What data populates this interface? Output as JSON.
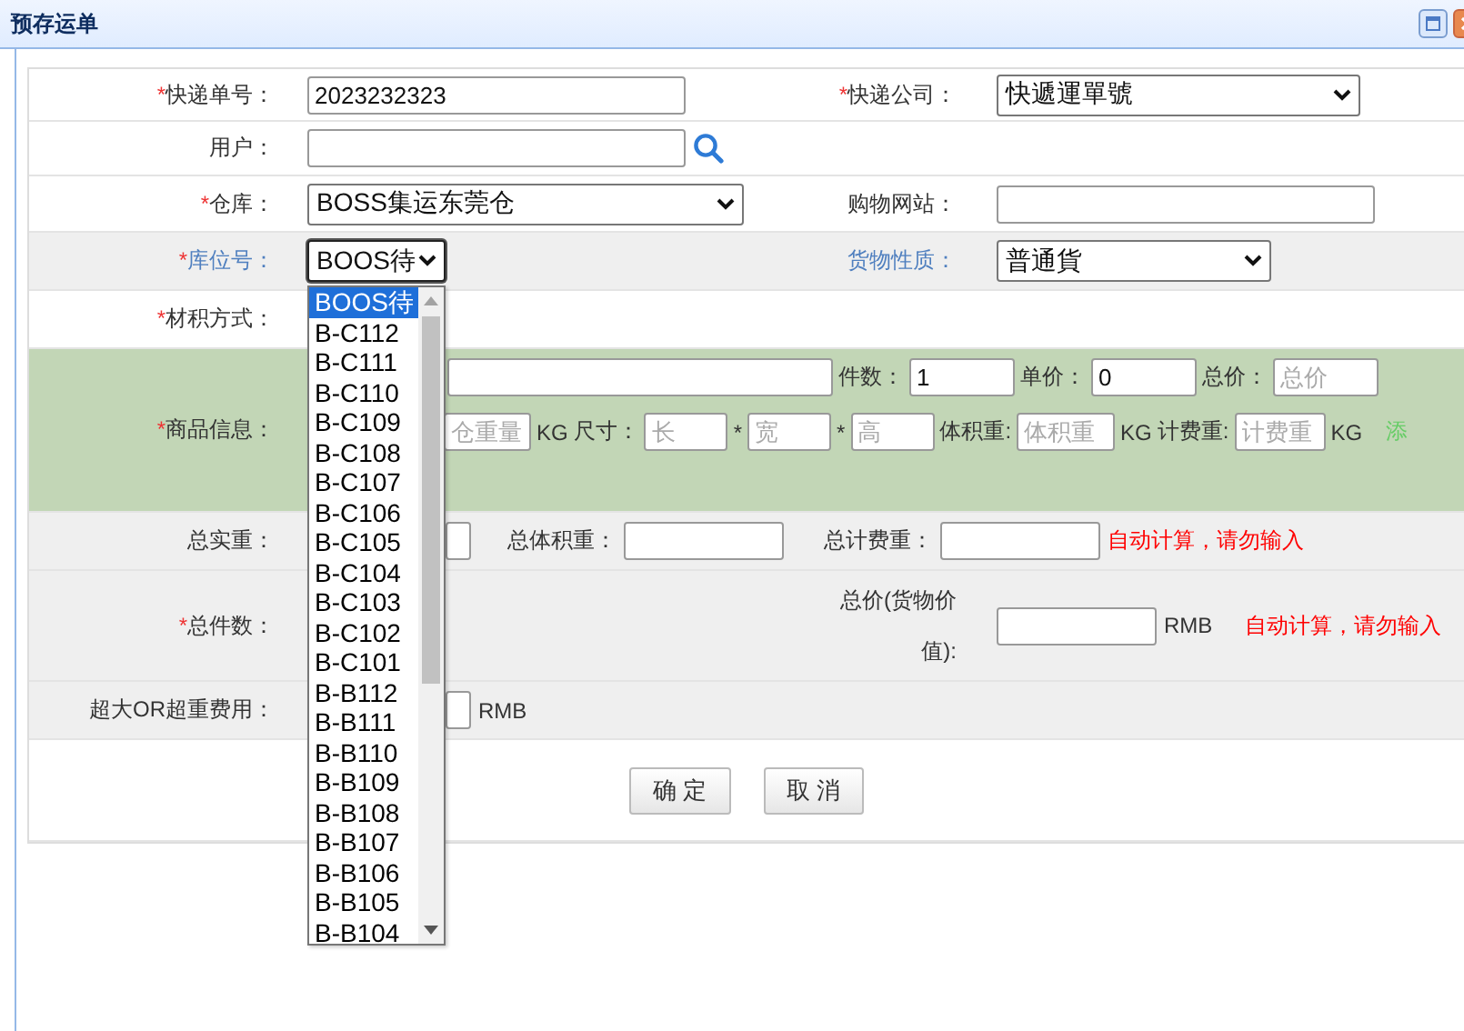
{
  "window": {
    "title": "预存运单"
  },
  "express_no": {
    "label": "快递单号：",
    "required_mark": "*",
    "highlighted": false,
    "value": "2023232323"
  },
  "express_company": {
    "label": "快递公司：",
    "required_mark": "*",
    "highlighted": false,
    "value": "快遞運單號"
  },
  "user": {
    "label": "用户：",
    "highlighted": false
  },
  "warehouse": {
    "label": "仓库：",
    "required_mark": "*",
    "highlighted": false,
    "value": "BOSS集运东莞仓"
  },
  "shopping_site": {
    "label": "购物网站：",
    "highlighted": false
  },
  "location": {
    "label": "库位号：",
    "required_mark": "*",
    "highlighted": true,
    "value": "BOOS待",
    "expanded": true,
    "options": [
      {
        "label": "BOOS待",
        "selected": true
      },
      {
        "label": "B-C112",
        "selected": false
      },
      {
        "label": "B-C111",
        "selected": false
      },
      {
        "label": "B-C110",
        "selected": false
      },
      {
        "label": "B-C109",
        "selected": false
      },
      {
        "label": "B-C108",
        "selected": false
      },
      {
        "label": "B-C107",
        "selected": false
      },
      {
        "label": "B-C106",
        "selected": false
      },
      {
        "label": "B-C105",
        "selected": false
      },
      {
        "label": "B-C104",
        "selected": false
      },
      {
        "label": "B-C103",
        "selected": false
      },
      {
        "label": "B-C102",
        "selected": false
      },
      {
        "label": "B-C101",
        "selected": false
      },
      {
        "label": "B-B112",
        "selected": false
      },
      {
        "label": "B-B111",
        "selected": false
      },
      {
        "label": "B-B110",
        "selected": false
      },
      {
        "label": "B-B109",
        "selected": false
      },
      {
        "label": "B-B108",
        "selected": false
      },
      {
        "label": "B-B107",
        "selected": false
      },
      {
        "label": "B-B106",
        "selected": false
      },
      {
        "label": "B-B105",
        "selected": false
      },
      {
        "label": "B-B104",
        "selected": false
      }
    ]
  },
  "cargo_type": {
    "label": "货物性质：",
    "highlighted": true,
    "value": "普通貨"
  },
  "volume_method": {
    "label": "材积方式：",
    "required_mark": "*",
    "highlighted": false
  },
  "product": {
    "label": "商品信息：",
    "required_mark": "*",
    "highlighted": false,
    "qty": {
      "label": "件数：",
      "value": "1"
    },
    "unit_price": {
      "label": "单价：",
      "value": "0"
    },
    "total_price": {
      "label": "总价：",
      "placeholder": "总价"
    },
    "weight": {
      "placeholder": "仓重量",
      "unit": "KG"
    },
    "size": {
      "label": "尺寸：",
      "placeholders": [
        "长",
        "宽",
        "高"
      ],
      "separators": [
        "*",
        "*"
      ]
    },
    "volume_weight": {
      "label": "体积重:",
      "placeholder": "体积重",
      "unit": "KG"
    },
    "charge_weight": {
      "label": "计费重:",
      "placeholder": "计费重",
      "unit": "KG"
    },
    "add": "添"
  },
  "totals": {
    "actual": {
      "label": "总实重：",
      "highlighted": false
    },
    "volume": {
      "label": "总体积重："
    },
    "charge": {
      "label": "总计费重："
    },
    "note": "自动计算，请勿输入"
  },
  "pieces": {
    "label": "总件数：",
    "required_mark": "*",
    "highlighted": false
  },
  "total_value": {
    "label": "总价(货物价值):",
    "highlighted": false,
    "unit": "RMB",
    "note": "自动计算，请勿输入"
  },
  "oversize": {
    "label": "超大OR超重费用：",
    "highlighted": false,
    "unit": "RMB"
  },
  "buttons": [
    {
      "label": "确 定"
    },
    {
      "label": "取 消"
    }
  ]
}
